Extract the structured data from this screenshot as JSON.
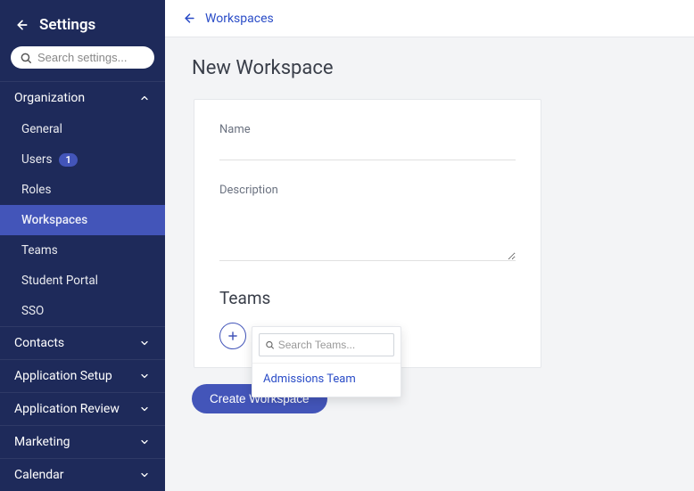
{
  "sidebar": {
    "title": "Settings",
    "search_placeholder": "Search settings...",
    "groups": {
      "organization": {
        "label": "Organization",
        "expanded": true
      },
      "contacts": {
        "label": "Contacts"
      },
      "application_setup": {
        "label": "Application Setup"
      },
      "application_review": {
        "label": "Application Review"
      },
      "marketing": {
        "label": "Marketing"
      },
      "calendar": {
        "label": "Calendar"
      }
    },
    "org_items": {
      "general": "General",
      "users": "Users",
      "users_badge": "1",
      "roles": "Roles",
      "workspaces": "Workspaces",
      "teams": "Teams",
      "student_portal": "Student Portal",
      "sso": "SSO"
    }
  },
  "breadcrumb": {
    "label": "Workspaces"
  },
  "page": {
    "title": "New Workspace",
    "name_label": "Name",
    "description_label": "Description",
    "teams_label": "Teams"
  },
  "popover": {
    "search_placeholder": "Search Teams...",
    "items": {
      "0": "Admissions Team"
    }
  },
  "cta": {
    "label": "Create Workspace"
  }
}
